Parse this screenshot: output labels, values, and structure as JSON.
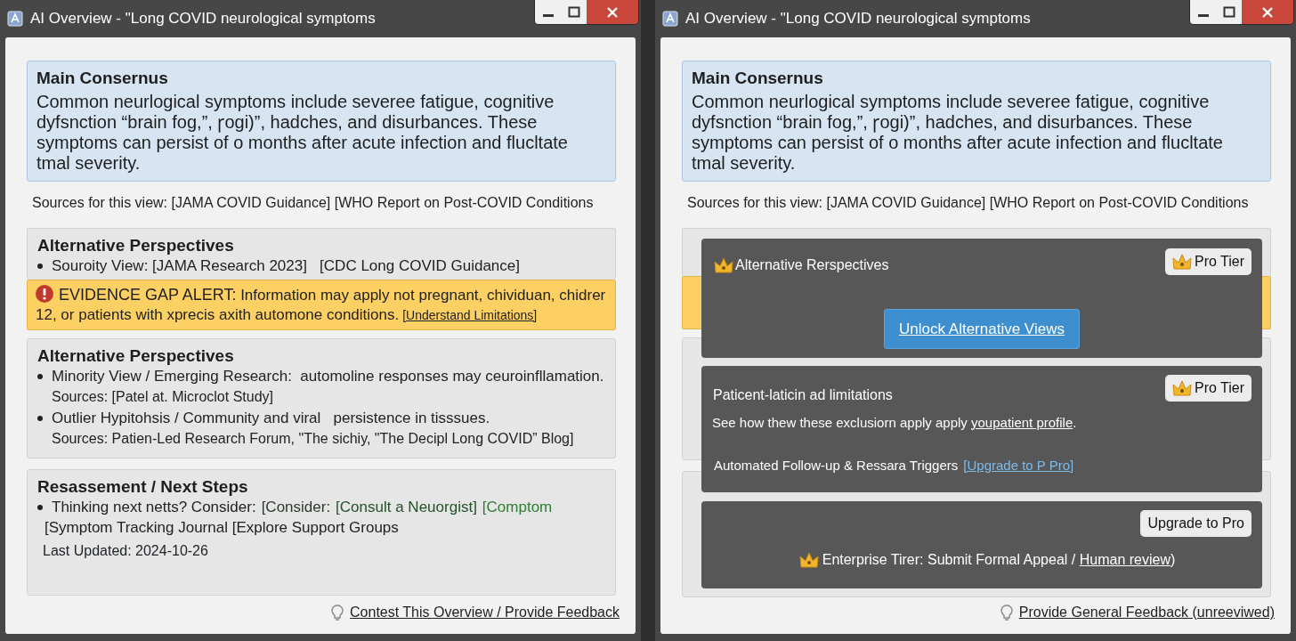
{
  "windows": [
    {
      "title": "AI Overview - \"Long COVID neurological symptoms",
      "consensus": {
        "heading": "Main Consernus",
        "body": "Common neurlogical symptoms include severee fatigue, cognitive dyfsnction “brain fog,”, ꞅogi)”, hadches, and disurbances. These symptoms can persist of o months after acute infection and flucltate tmal severity."
      },
      "sources_line": "Sources for this view: [JAMA COVID Guidance] [WHO Report on Post-COVID Conditions",
      "sections": [
        {
          "kind": "perspectives",
          "heading": "Alternative Perspectives",
          "items": [
            {
              "text": "Souroity View: [JAMA Research 2023]   [CDC Long COVID Guidance]"
            }
          ]
        },
        {
          "kind": "alert",
          "label": "EVIDENCE GAP ALERT:",
          "text": "Information may apply not pregnant, chividuan, chidrer 12, or patients with xprecis axith automone conditions.",
          "link": "[Understand Limitations]"
        },
        {
          "kind": "perspectives",
          "heading": "Alternative Perspectives",
          "items": [
            {
              "text": "Minority View / Emerging Research:  automoline responses may ceuroinfllamation.",
              "sources": "Sources: [Patel at.  Microclot Study]"
            },
            {
              "text": "Outlier Hypitohsis / Community and viral   persistence in tisssues.",
              "sources": "Sources: Patien-Led Research Forum, \"The sichiy, \"The Decipl Long COVID” Blog]"
            }
          ]
        },
        {
          "kind": "next_steps",
          "heading": "Resassement / Next Steps",
          "items": [
            {
              "text": "Thinking next netts? Consider:",
              "links": [
                {
                  "text": "[Consider:",
                  "color": "#2b3b2b"
                },
                {
                  "text": "[Consult a Neuorgist]",
                  "color": "#24502a"
                },
                {
                  "text": "[Comptom",
                  "color": "#2e7d32"
                }
              ],
              "more": "[Symptom Tracking Journal [Explore Support Groups"
            }
          ],
          "updated": "Last Updated: 2024-10-26"
        }
      ],
      "feedback_link": "Contest This Overview / Provide Feedback"
    },
    {
      "title": "AI Overview - \"Long COVID neurological symptoms",
      "consensus": {
        "heading": "Main Consernus",
        "body": "Common neurlogical symptoms include severee fatigue, cognitive dyfsnction “brain fog,”, ꞅogi)”, hadches, and disurbances. These symptoms can persist of o months after acute infection and flucltate tmal severity."
      },
      "sources_line": "Sources for this view: [JAMA COVID Guidance] [WHO Report on Post-COVID Conditions",
      "overlays": [
        {
          "kind": "unlock",
          "crown": true,
          "heading": "Alternative Rerspectives",
          "badge": {
            "text": "Pro Tier",
            "crown": true
          },
          "button": "Unlock Alternative Views"
        },
        {
          "kind": "profile",
          "crown": false,
          "heading": "Paticent-laticin ad limitations",
          "badge": {
            "text": "Pro Tier",
            "crown": true
          },
          "text": "See how thew these exclusiorn apply apply ",
          "link": "youpatient profile",
          "tail": ".",
          "line2": "Automated Follow-up & Ressara Triggers",
          "link2": "[Upgrade to P Pro]"
        },
        {
          "kind": "enterprise",
          "crown": true,
          "badge": {
            "text": "Upgrade to Pro",
            "crown": false
          },
          "text": "Enterprise Tirer: Submit Formal Appeal / ",
          "link": "Human review",
          "tail": ")"
        }
      ],
      "feedback_link": "Provide General Feedback (unreeviwed)"
    }
  ]
}
